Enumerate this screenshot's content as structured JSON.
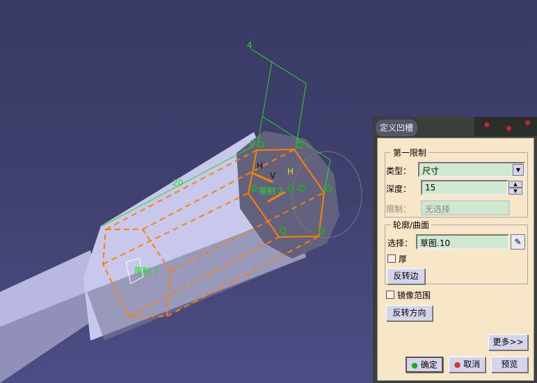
{
  "viewport": {
    "labels": {
      "dim_4": "4",
      "dim_20": "20",
      "dim_0": "0",
      "axis_h1": "H",
      "axis_v": "V",
      "axis_h2": "H",
      "limit_2": "限制 2",
      "limit_1": "限制 1"
    },
    "colors": {
      "sketch": "#ff8000",
      "constraint": "#22dd22",
      "background": "#3a3a66"
    }
  },
  "dialog": {
    "title": "定义凹槽",
    "first_limit": {
      "group_title": "第一限制",
      "type_label": "类型：",
      "type_value": "尺寸",
      "depth_label": "深度：",
      "depth_value": "15",
      "limit_label": "限制：",
      "limit_value": "无选择"
    },
    "profile": {
      "group_title": "轮廓/曲面",
      "select_label": "选择：",
      "select_value": "草图.10",
      "thick_label": "厚",
      "reverse_side": "反转边"
    },
    "mirrored_extent": "镜像范围",
    "reverse_direction": "反转方向",
    "more": "更多>>",
    "ok": "确定",
    "cancel": "取消",
    "preview": "预览"
  }
}
